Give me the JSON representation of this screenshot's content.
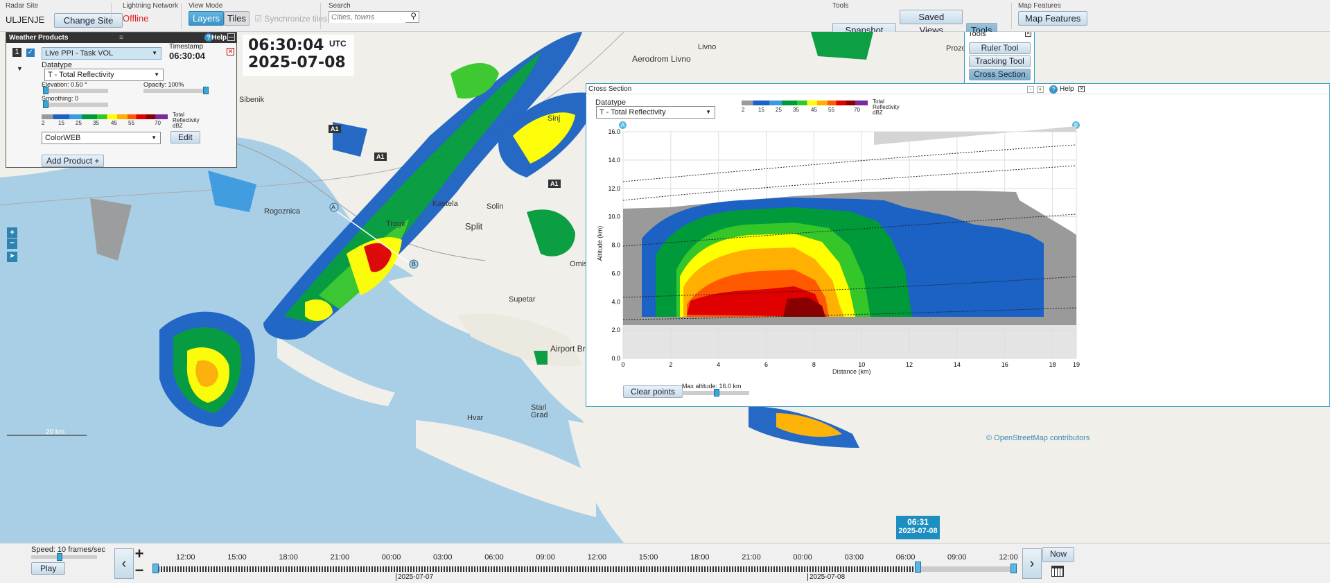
{
  "toolbar": {
    "radar_site": {
      "caption": "Radar Site",
      "value": "ULJENJE",
      "button": "Change Site"
    },
    "lightning": {
      "caption": "Lightning Network",
      "status": "Offline"
    },
    "view_mode": {
      "caption": "View Mode",
      "layers": "Layers",
      "tiles": "Tiles",
      "sync": "Synchronize tiles"
    },
    "search": {
      "caption": "Search",
      "placeholder": "Cities, towns"
    },
    "tools": {
      "caption": "Tools",
      "snapshot": "Snapshot",
      "saved_views": "Saved Views",
      "tools": "Tools"
    },
    "map_features": {
      "caption": "Map Features",
      "button": "Map Features"
    }
  },
  "time_display": {
    "time": "06:30:04",
    "zone": "UTC",
    "date": "2025-07-08"
  },
  "weather_panel": {
    "title": "Weather Products",
    "help": "Help",
    "index": "1",
    "product": "Live PPI - Task VOL",
    "timestamp_label": "Timestamp",
    "timestamp": "06:30:04",
    "datatype_label": "Datatype",
    "datatype": "T - Total Reflectivity",
    "elevation": "Elevation: 0.50 °",
    "opacity": "Opacity: 100%",
    "smoothing": "Smoothing: 0",
    "legend_ticks": [
      "2",
      "15",
      "25",
      "35",
      "45",
      "55",
      "70"
    ],
    "legend_title": "Total",
    "legend_title2": "Reflectivity",
    "legend_unit": "dBZ",
    "palette": "ColorWEB",
    "edit": "Edit",
    "add_product": "Add Product +"
  },
  "tools_panel": {
    "title": "Tools",
    "ruler": "Ruler Tool",
    "tracking": "Tracking Tool",
    "cross": "Cross Section"
  },
  "map_labels": [
    "Sibenik",
    "Aerodrom Livno",
    "Livno",
    "Prozor",
    "Sinj",
    "Rogoznica",
    "Kastela",
    "Trogir",
    "Solin",
    "Split",
    "Omis",
    "Supetar",
    "Airport Brac",
    "Stari",
    "Grad",
    "Hvar",
    "20 km",
    "© OpenStreetMap contributors"
  ],
  "roads": [
    "A1",
    "A1",
    "A1",
    "A1"
  ],
  "cross_section": {
    "title": "Cross Section",
    "help": "Help",
    "datatype_label": "Datatype",
    "datatype": "T - Total Reflectivity",
    "point_a": "A",
    "point_b": "B",
    "clear": "Clear points",
    "max_alt": "Max altitude: 16.0 km",
    "xlabel": "Distance (km)",
    "ylabel": "Altitude (km)",
    "xticks": [
      "0",
      "2",
      "4",
      "6",
      "8",
      "10",
      "12",
      "14",
      "16",
      "18",
      "19"
    ],
    "yticks": [
      "0.0",
      "2.0",
      "4.0",
      "6.0",
      "8.0",
      "10.0",
      "12.0",
      "14.0",
      "16.0"
    ],
    "legend_ticks": [
      "2",
      "15",
      "25",
      "35",
      "45",
      "55",
      "70"
    ],
    "legend_title": "Total",
    "legend_title2": "Reflectivity",
    "legend_unit": "dBZ"
  },
  "timeline": {
    "speed": "Speed: 10 frames/sec",
    "play": "Play",
    "now": "Now",
    "ticks": [
      "12:00",
      "15:00",
      "18:00",
      "21:00",
      "00:00",
      "03:00",
      "06:00",
      "09:00",
      "12:00",
      "15:00",
      "18:00",
      "21:00",
      "00:00",
      "03:00",
      "06:00",
      "09:00",
      "12:00"
    ],
    "dates": [
      "2025-07-07",
      "2025-07-08"
    ],
    "current_time": "06:31",
    "current_date": "2025-07-08"
  },
  "colors": {
    "accent": "#3a93c8",
    "offline": "#e02020",
    "reflectivity": [
      "#9a9a9a",
      "#1b62c4",
      "#3c9be0",
      "#009a3a",
      "#35c72a",
      "#ffff00",
      "#ffb000",
      "#ff5a00",
      "#e00000",
      "#8a0000",
      "#7a2a9a"
    ]
  }
}
